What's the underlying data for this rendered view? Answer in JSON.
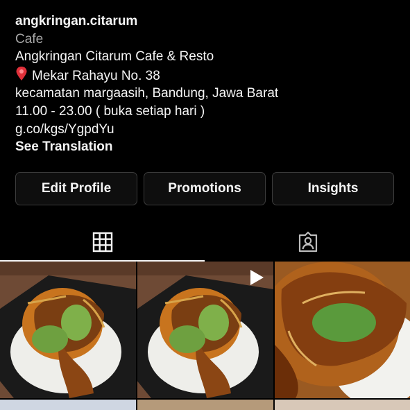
{
  "profile": {
    "username": "angkringan.citarum",
    "category": "Cafe",
    "bio_lines": [
      "Angkringan Citarum Cafe & Resto",
      "Mekar Rahayu No. 38",
      "kecamatan margaasih, Bandung, Jawa Barat",
      "11.00 - 23.00 ( buka setiap hari )",
      "g.co/kgs/YgpdYu"
    ],
    "see_translation": "See Translation"
  },
  "buttons": {
    "edit_profile": "Edit Profile",
    "promotions": "Promotions",
    "insights": "Insights"
  },
  "tabs": {
    "active": "posts-grid",
    "items": [
      "posts-grid",
      "tagged"
    ]
  },
  "icons": {
    "pin": "location-pin-icon",
    "grid": "grid-icon",
    "tagged": "tagged-person-icon",
    "video": "play-icon"
  },
  "posts": [
    {
      "type": "image",
      "label": "food photo"
    },
    {
      "type": "video",
      "label": "food photo"
    },
    {
      "type": "image",
      "label": "food photo"
    }
  ],
  "colors": {
    "background": "#000000",
    "text": "#f5f5f5",
    "secondary_text": "#a8a8a8",
    "button_border": "#3c3c3c"
  }
}
